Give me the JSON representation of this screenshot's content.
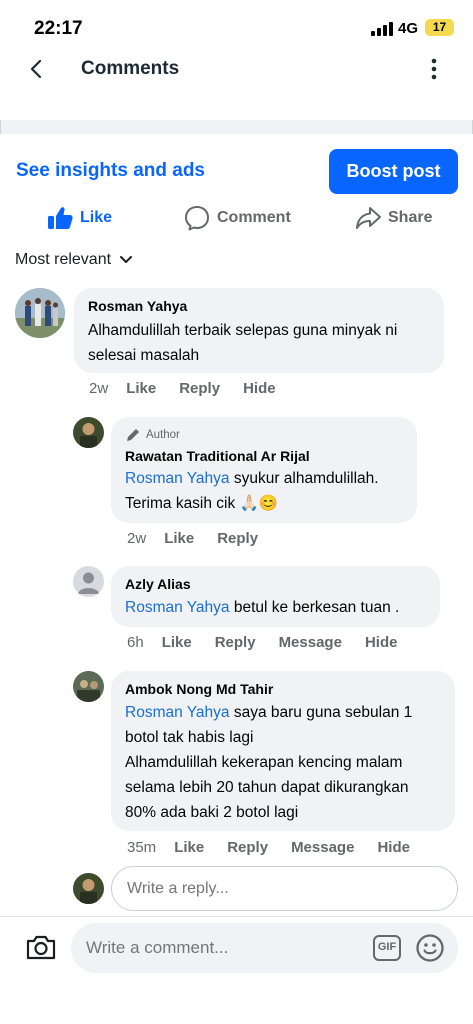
{
  "status_bar": {
    "time": "22:17",
    "network": "4G",
    "battery": "17"
  },
  "header": {
    "title": "Comments"
  },
  "post_actions": {
    "insights_label": "See insights and ads",
    "boost_label": "Boost post",
    "like_label": "Like",
    "comment_label": "Comment",
    "share_label": "Share"
  },
  "sort": {
    "label": "Most relevant"
  },
  "comments": [
    {
      "name": "Rosman Yahya",
      "lines": [
        "Alhamdulillah terbaik selepas guna minyak ni",
        "selesai masalah"
      ],
      "age": "2w",
      "like": "Like",
      "reply": "Reply",
      "hide": "Hide"
    },
    {
      "author_tag": "Author",
      "name": "Rawatan Traditional Ar Rijal",
      "mention": "Rosman Yahya",
      "line1_rest": " syukur alhamdulillah.",
      "line2": "Terima kasih cik 🙏🏻😊",
      "age": "2w",
      "like": "Like",
      "reply": "Reply"
    },
    {
      "name": "Azly Alias",
      "mention": "Rosman Yahya",
      "line1_rest": " betul ke berkesan tuan .",
      "age": "6h",
      "like": "Like",
      "reply": "Reply",
      "message": "Message",
      "hide": "Hide"
    },
    {
      "name": "Ambok Nong Md Tahir",
      "mention": "Rosman Yahya",
      "line1_rest": " saya baru guna sebulan 1",
      "lines": [
        "botol tak habis lagi",
        "Alhamdulillah kekerapan kencing malam",
        "selama lebih 20 tahun dapat dikurangkan",
        "80% ada baki 2 botol lagi"
      ],
      "age": "35m",
      "like": "Like",
      "reply": "Reply",
      "message": "Message",
      "hide": "Hide"
    }
  ],
  "reply_box": {
    "placeholder": "Write a reply..."
  },
  "comment_bar": {
    "placeholder": "Write a comment...",
    "gif_label": "GIF"
  }
}
